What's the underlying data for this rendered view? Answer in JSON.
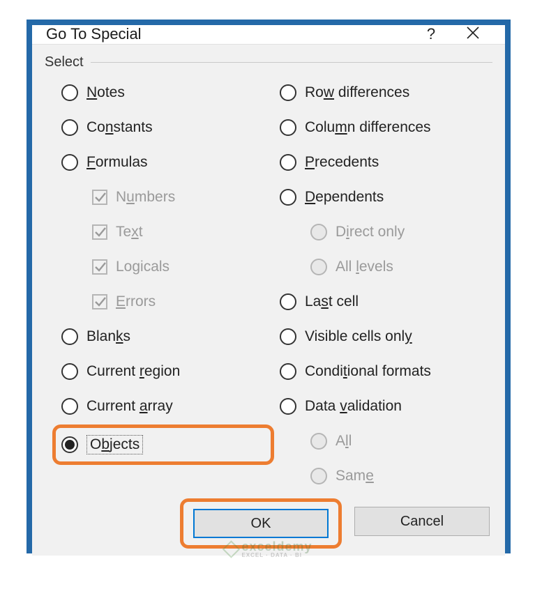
{
  "dialog": {
    "title": "Go To Special",
    "group_label": "Select",
    "left": [
      {
        "type": "radio",
        "text_before": "",
        "under": "N",
        "text_after": "otes"
      },
      {
        "type": "radio",
        "text_before": "Co",
        "under": "n",
        "text_after": "stants"
      },
      {
        "type": "radio",
        "text_before": "",
        "under": "F",
        "text_after": "ormulas"
      },
      {
        "type": "check",
        "sub": true,
        "disabled": true,
        "text_before": "N",
        "under": "u",
        "text_after": "mbers"
      },
      {
        "type": "check",
        "sub": true,
        "disabled": true,
        "text_before": "Te",
        "under": "x",
        "text_after": "t"
      },
      {
        "type": "check",
        "sub": true,
        "disabled": true,
        "text_before": "Lo",
        "under": "g",
        "text_after": "icals"
      },
      {
        "type": "check",
        "sub": true,
        "disabled": true,
        "text_before": "",
        "under": "E",
        "text_after": "rrors"
      },
      {
        "type": "radio",
        "text_before": "Blan",
        "under": "k",
        "text_after": "s"
      },
      {
        "type": "radio",
        "text_before": "Current ",
        "under": "r",
        "text_after": "egion"
      },
      {
        "type": "radio",
        "text_before": "Current ",
        "under": "a",
        "text_after": "rray"
      },
      {
        "type": "radio",
        "selected": true,
        "highlight": true,
        "focus": true,
        "text_before": "O",
        "under": "b",
        "text_after": "jects"
      }
    ],
    "right": [
      {
        "type": "radio",
        "text_before": "Ro",
        "under": "w",
        "text_after": " differences"
      },
      {
        "type": "radio",
        "text_before": "Colu",
        "under": "m",
        "text_after": "n differences"
      },
      {
        "type": "radio",
        "text_before": "",
        "under": "P",
        "text_after": "recedents"
      },
      {
        "type": "radio",
        "text_before": "",
        "under": "D",
        "text_after": "ependents"
      },
      {
        "type": "radio",
        "sub": true,
        "disabled": true,
        "text_before": "D",
        "under": "i",
        "text_after": "rect only"
      },
      {
        "type": "radio",
        "sub": true,
        "disabled": true,
        "text_before": "All ",
        "under": "l",
        "text_after": "evels"
      },
      {
        "type": "radio",
        "text_before": "La",
        "under": "s",
        "text_after": "t cell"
      },
      {
        "type": "radio",
        "text_before": "Visible cells onl",
        "under": "y",
        "text_after": ""
      },
      {
        "type": "radio",
        "text_before": "Condi",
        "under": "t",
        "text_after": "ional formats"
      },
      {
        "type": "radio",
        "text_before": "Data ",
        "under": "v",
        "text_after": "alidation"
      },
      {
        "type": "radio",
        "sub": true,
        "disabled": true,
        "text_before": "A",
        "under": "l",
        "text_after": "l"
      },
      {
        "type": "radio",
        "sub": true,
        "disabled": true,
        "text_before": "Sam",
        "under": "e",
        "text_after": ""
      }
    ],
    "buttons": {
      "ok": "OK",
      "cancel": "Cancel"
    }
  },
  "watermark": {
    "main": "exceldemy",
    "sub": "EXCEL · DATA · BI"
  }
}
